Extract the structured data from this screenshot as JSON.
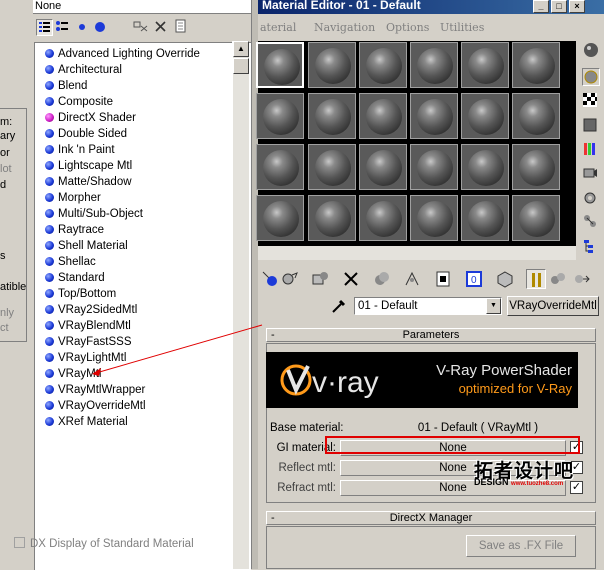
{
  "left_strip": {
    "fragments": [
      "m:",
      "ary",
      "or",
      "lot",
      "d",
      "s",
      "atible",
      "nly",
      "ct"
    ]
  },
  "browser": {
    "top_field": "None",
    "items": [
      {
        "label": "Advanced Lighting Override",
        "ball": "blue"
      },
      {
        "label": "Architectural",
        "ball": "blue"
      },
      {
        "label": "Blend",
        "ball": "blue"
      },
      {
        "label": "Composite",
        "ball": "blue"
      },
      {
        "label": "DirectX Shader",
        "ball": "magenta"
      },
      {
        "label": "Double Sided",
        "ball": "blue"
      },
      {
        "label": "Ink 'n Paint",
        "ball": "blue"
      },
      {
        "label": "Lightscape Mtl",
        "ball": "blue"
      },
      {
        "label": "Matte/Shadow",
        "ball": "blue"
      },
      {
        "label": "Morpher",
        "ball": "blue"
      },
      {
        "label": "Multi/Sub-Object",
        "ball": "blue"
      },
      {
        "label": "Raytrace",
        "ball": "blue"
      },
      {
        "label": "Shell Material",
        "ball": "blue"
      },
      {
        "label": "Shellac",
        "ball": "blue"
      },
      {
        "label": "Standard",
        "ball": "blue"
      },
      {
        "label": "Top/Bottom",
        "ball": "blue"
      },
      {
        "label": "VRay2SidedMtl",
        "ball": "blue"
      },
      {
        "label": "VRayBlendMtl",
        "ball": "blue"
      },
      {
        "label": "VRayFastSSS",
        "ball": "blue"
      },
      {
        "label": "VRayLightMtl",
        "ball": "blue"
      },
      {
        "label": "VRayMtl",
        "ball": "blue"
      },
      {
        "label": "VRayMtlWrapper",
        "ball": "blue"
      },
      {
        "label": "VRayOverrideMtl",
        "ball": "blue"
      },
      {
        "label": "XRef Material",
        "ball": "blue"
      }
    ]
  },
  "editor": {
    "title": "Material Editor - 01 - Default",
    "window_buttons": [
      "_",
      "□",
      "×"
    ],
    "menu": [
      "aterial",
      "Navigation",
      "Options",
      "Utilities"
    ],
    "material_name": "01 - Default",
    "material_type": "VRayOverrideMtl",
    "params_header": "Parameters",
    "collapse_glyph": "-",
    "banner": {
      "title": "V-Ray PowerShader",
      "subtitle": "optimized for V-Ray",
      "logo": "v·ray"
    },
    "rows": [
      {
        "label": "Base material:",
        "value": "01 - Default  ( VRayMtl )"
      },
      {
        "label": "GI material:",
        "value": "None",
        "checked": "✓"
      },
      {
        "label": "Reflect mtl:",
        "value": "None",
        "checked": "✓"
      },
      {
        "label": "Refract mtl:",
        "value": "None",
        "checked": "✓"
      }
    ],
    "dx_header": "DirectX Manager",
    "dx_checkbox_label": "DX Display of Standard Material",
    "save_fx_label": "Save as .FX File"
  },
  "watermark": {
    "line1": "拓者设计吧",
    "line2": "DESIGN",
    "url": "www.tuozhe8.com"
  }
}
